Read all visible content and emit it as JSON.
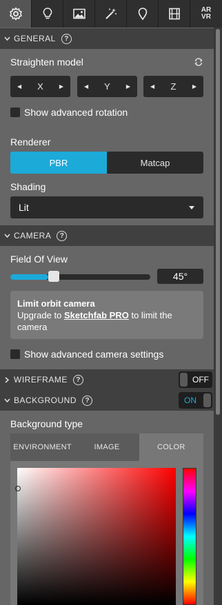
{
  "tabs": [
    {
      "icon": "gear-icon",
      "active": true
    },
    {
      "icon": "lightbulb-icon",
      "active": false
    },
    {
      "icon": "image-icon",
      "active": false
    },
    {
      "icon": "magic-wand-icon",
      "active": false
    },
    {
      "icon": "map-pin-icon",
      "active": false
    },
    {
      "icon": "film-icon",
      "active": false
    },
    {
      "icon": "ar-vr-icon",
      "label_top": "AR",
      "label_bottom": "VR",
      "active": false
    }
  ],
  "general": {
    "title": "GENERAL",
    "help": "?",
    "straighten_label": "Straighten model",
    "axes": [
      "X",
      "Y",
      "Z"
    ],
    "show_advanced_rotation": "Show advanced rotation",
    "renderer_label": "Renderer",
    "renderer_options": [
      "PBR",
      "Matcap"
    ],
    "renderer_selected": "PBR",
    "shading_label": "Shading",
    "shading_value": "Lit"
  },
  "camera": {
    "title": "CAMERA",
    "help": "?",
    "fov_label": "Field Of View",
    "fov_value": "45°",
    "fov_fraction": 0.27,
    "info_title": "Limit orbit camera",
    "info_pre": "Upgrade to ",
    "info_link": "Sketchfab PRO",
    "info_post": " to limit the camera",
    "show_advanced_camera": "Show advanced camera settings"
  },
  "wireframe": {
    "title": "WIREFRAME",
    "help": "?",
    "toggle": "OFF"
  },
  "background": {
    "title": "BACKGROUND",
    "help": "?",
    "toggle": "ON",
    "type_label": "Background type",
    "type_tabs": [
      "ENVIRONMENT",
      "IMAGE",
      "COLOR"
    ],
    "type_selected": "COLOR"
  },
  "colors": {
    "accent": "#1caad9",
    "panel": "#666666",
    "header": "#404040",
    "control": "#2a2a2a"
  }
}
